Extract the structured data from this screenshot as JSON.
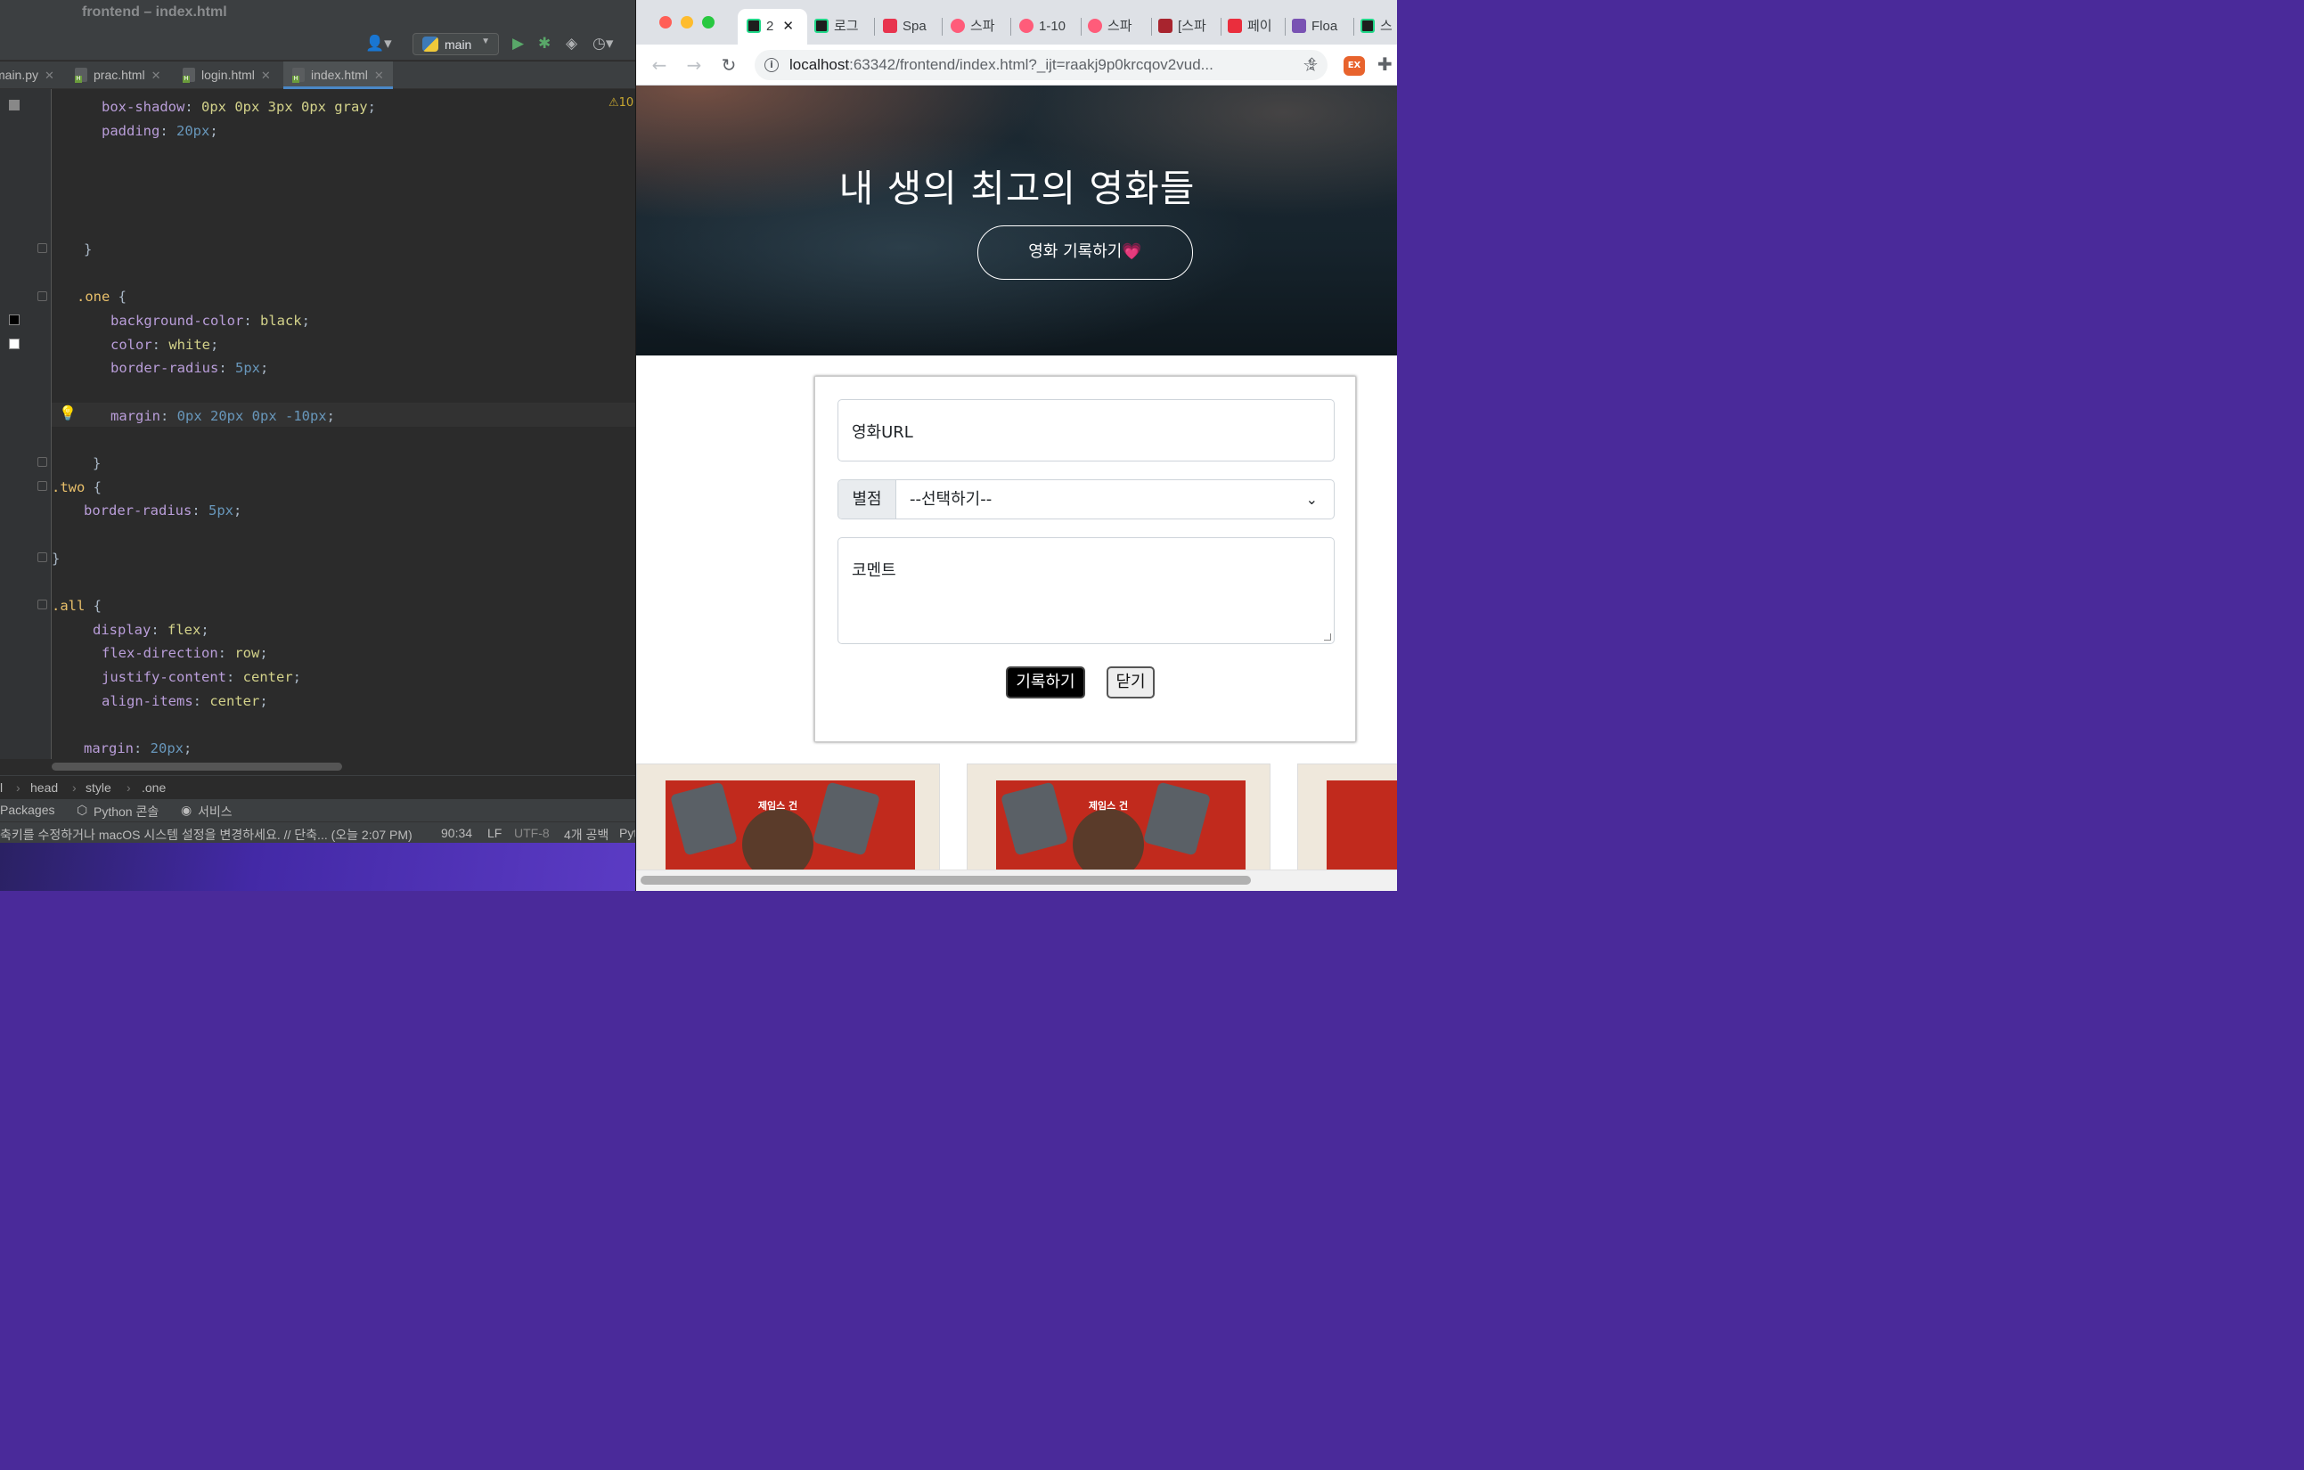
{
  "ide": {
    "window_title": "frontend – index.html",
    "run_config": "main",
    "tabs": [
      {
        "label": "main.py"
      },
      {
        "label": "prac.html"
      },
      {
        "label": "login.html"
      },
      {
        "label": "index.html"
      }
    ],
    "warning_count": "10",
    "code": [
      {
        "prop": "box-shadow",
        "value": "0px 0px 3px 0px gray"
      },
      {
        "prop": "padding",
        "value": "20px"
      },
      {
        "sel": ".one"
      },
      {
        "prop": "background-color",
        "value": "black"
      },
      {
        "prop": "color",
        "value": "white"
      },
      {
        "prop": "border-radius",
        "value": "5px"
      },
      {
        "prop": "margin",
        "value": "0px 20px 0px -10px"
      },
      {
        "sel": ".two"
      },
      {
        "prop": "border-radius",
        "value": "5px"
      },
      {
        "sel": ".all"
      },
      {
        "prop": "display",
        "value": "flex"
      },
      {
        "prop": "flex-direction",
        "value": "row"
      },
      {
        "prop": "justify-content",
        "value": "center"
      },
      {
        "prop": "align-items",
        "value": "center"
      },
      {
        "prop": "margin",
        "value": "20px"
      }
    ],
    "breadcrumb": [
      "l",
      "head",
      "style",
      ".one"
    ],
    "tool_windows": [
      "Packages",
      "Python 콘솔",
      "서비스"
    ],
    "status_message": "축키를 수정하거나 macOS 시스템 설정을 변경하세요. // 단축... (오늘 2:07 PM)",
    "status": {
      "position": "90:34",
      "line_sep": "LF",
      "encoding": "UTF-8",
      "indent": "4개 공백",
      "interpreter": "Pyt"
    }
  },
  "browser": {
    "tabs": [
      {
        "label": "2",
        "icon": "pycharm-icon",
        "active": true
      },
      {
        "label": "로그",
        "icon": "pycharm-icon"
      },
      {
        "label": "Spa",
        "icon": "sparta-icon"
      },
      {
        "label": "스파",
        "icon": "sparta-heart-icon"
      },
      {
        "label": "1-10",
        "icon": "sparta-heart-icon"
      },
      {
        "label": "스파",
        "icon": "sparta-heart-icon"
      },
      {
        "label": "[스파",
        "icon": "book-icon"
      },
      {
        "label": "페이",
        "icon": "bolt-icon"
      },
      {
        "label": "Floa",
        "icon": "bootstrap-icon"
      },
      {
        "label": "스",
        "icon": "pycharm-icon"
      }
    ],
    "url_host": "localhost",
    "url_rest": ":63342/frontend/index.html?_ijt=raakj9p0krcqov2vud...",
    "extension_label": "EX"
  },
  "page": {
    "hero_title": "내 생의 최고의 영화들",
    "hero_button": "영화 기록하기💗",
    "form": {
      "url_placeholder": "영화URL",
      "star_label": "별점",
      "star_selected": "--선택하기--",
      "comment_placeholder": "코멘트",
      "save_button": "기록하기",
      "close_button": "닫기"
    },
    "cards": [
      {
        "poster_title": "제임스 건"
      },
      {
        "poster_title": "제임스 건"
      },
      {
        "poster_title": ""
      }
    ]
  }
}
